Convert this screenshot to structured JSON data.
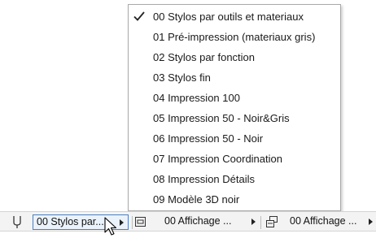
{
  "menu": {
    "items": [
      {
        "label": "00 Stylos par outils et materiaux",
        "checked": true
      },
      {
        "label": "01 Pré-impression (materiaux gris)",
        "checked": false
      },
      {
        "label": "02 Stylos par fonction",
        "checked": false
      },
      {
        "label": "03 Stylos fin",
        "checked": false
      },
      {
        "label": "04 Impression 100",
        "checked": false
      },
      {
        "label": "05 Impression 50 - Noir&Gris",
        "checked": false
      },
      {
        "label": "06 Impression 50 - Noir",
        "checked": false
      },
      {
        "label": "07 Impression Coordination",
        "checked": false
      },
      {
        "label": "08 Impression Détails",
        "checked": false
      },
      {
        "label": "09 Modèle 3D noir",
        "checked": false
      }
    ],
    "check_icon": "checkmark-icon"
  },
  "toolbar": {
    "pen_set_icon": "pen-icon",
    "pen_set_label": "00 Stylos par...",
    "model_view_icon": "model-view-icon",
    "model_view_label": "00 Affichage ...",
    "layout_view_icon": "layout-view-icon",
    "layout_view_label": "00 Affichage ..."
  },
  "colors": {
    "accent": "#4a7fc1",
    "active_bg": "#eaf2fb",
    "menu_border": "#a9a9a9"
  }
}
